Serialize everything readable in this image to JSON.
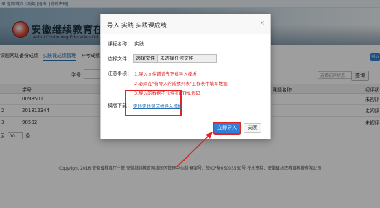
{
  "topbar": {
    "links": "录 返回首页 |切换| |退出| |修改密码|"
  },
  "banner": {
    "title": "安徽继续教育在",
    "subtitle": "Anhui Continuing Education Onli"
  },
  "tabs": [
    {
      "label": "课题网动备份成绩",
      "active": false
    },
    {
      "label": "实践课成绩管理",
      "active": true
    },
    {
      "label": "补考成绩",
      "active": false
    }
  ],
  "import_short": "导入",
  "filter": {
    "student_id_label": "学号：",
    "status_placeholder": "选择初评状态",
    "query_label": "查询"
  },
  "table": {
    "headers": {
      "id": "学号",
      "course": "课题名称",
      "status": "初评状"
    },
    "rows": [
      {
        "index": "1",
        "id": "0098501",
        "status": "未初评"
      },
      {
        "index": "2",
        "id": "201812344",
        "status": "未初评"
      },
      {
        "index": "3",
        "id": "98502",
        "status": "未初评"
      }
    ]
  },
  "pager": {
    "prefix": "示",
    "value": "10",
    "suffix": "条"
  },
  "footer": "Copyright 2016 安徽省教育厅主管 安徽继续教育网络园区管理中心制 备案号：皖ICP备05003560号 技术支持：安徽省纷辉教育科技有限公司",
  "modal": {
    "title": "导入 实践 实践课成绩",
    "close_symbol": "×",
    "course_label": "课程名称：",
    "course_value": "实践",
    "file_label": "选择文件：",
    "file_button": "选择文件",
    "file_status": "未选择任何文件",
    "notes_label": "注意事项：",
    "notes": [
      "1.导入文件前请先下载导入模板",
      "2.必须在\"待导入的成绩列表\"工作表中填写数据",
      "3.导入的数据不允许有HTML代码"
    ],
    "template_label": "模版下载：",
    "template_link": "实践实践课成绩导入模板",
    "import_button": "立即导入",
    "close_button": "关闭"
  },
  "colors": {
    "primary": "#2f7ed8",
    "highlight": "#e32222",
    "note_text": "#e02020",
    "link": "#2a6fb0"
  }
}
